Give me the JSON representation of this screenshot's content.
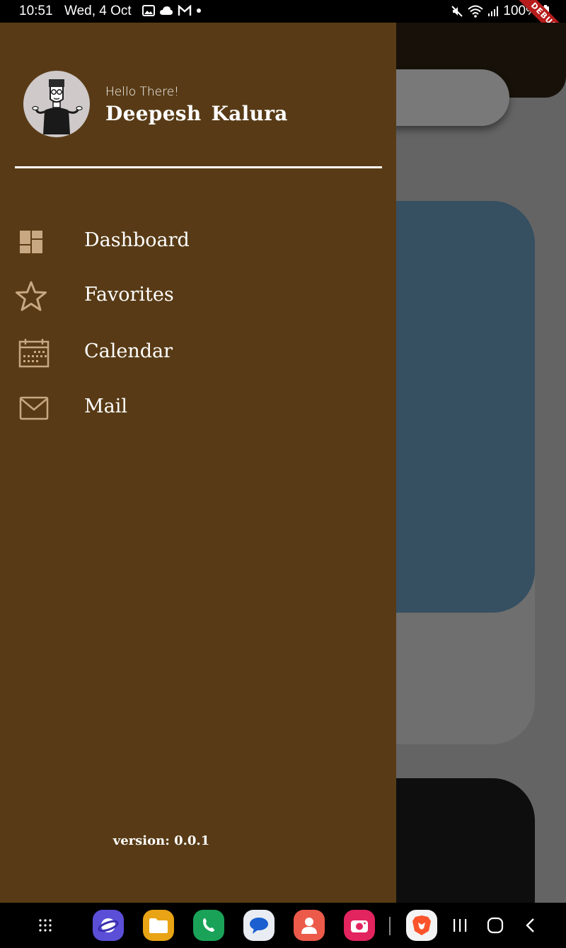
{
  "status_bar": {
    "time": "10:51",
    "date": "Wed, 4 Oct",
    "battery": "100%",
    "debug_banner": "DEBUG"
  },
  "drawer": {
    "greeting": "Hello There!",
    "user_name": "Deepesh  Kalura",
    "items": [
      {
        "label": "Dashboard",
        "icon": "dashboard-icon"
      },
      {
        "label": "Favorites",
        "icon": "star-icon"
      },
      {
        "label": "Calendar",
        "icon": "calendar-icon"
      },
      {
        "label": "Mail",
        "icon": "mail-icon"
      }
    ],
    "version": "version: 0.0.1"
  },
  "colors": {
    "drawer_bg": "#583b16",
    "icon_tint": "#c8a882",
    "text": "#ffffff"
  },
  "dock": {
    "apps": [
      "app-drawer-icon",
      "samsung-internet-icon",
      "my-files-icon",
      "phone-icon",
      "messages-icon",
      "contacts-icon",
      "camera-icon",
      "brave-browser-icon"
    ],
    "system": [
      "recent-apps-icon",
      "home-icon",
      "back-icon"
    ]
  }
}
